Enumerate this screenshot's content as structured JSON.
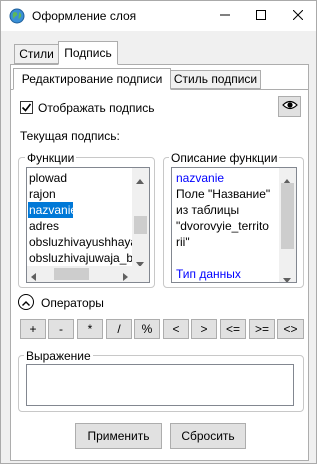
{
  "window": {
    "title": "Оформление слоя",
    "icon": "globe-icon",
    "controls": [
      "minimize-icon",
      "maximize-icon",
      "close-icon"
    ]
  },
  "tabs": {
    "top": [
      {
        "label": "Стили",
        "active": false
      },
      {
        "label": "Подпись",
        "active": true
      }
    ],
    "inner": [
      {
        "label": "Редактирование подписи",
        "active": true
      },
      {
        "label": "Стиль подписи",
        "active": false
      }
    ]
  },
  "label_options": {
    "show_label_text": "Отображать подпись",
    "show_label_checked": true,
    "preview_icon": "eye-icon",
    "current_label_heading": "Текущая подпись:"
  },
  "functions": {
    "legend": "Функции",
    "items": [
      "plowad",
      "rajon",
      "nazvanie",
      "adres",
      "obsluzhivayushhaya",
      "obsluzhivajuwaja_bi"
    ],
    "selected": "nazvanie"
  },
  "description": {
    "legend": "Описание функции",
    "name": "nazvanie",
    "lines": [
      "Поле \"Название\"",
      "из таблицы",
      "\"dvorovyie_territo",
      "rii\""
    ],
    "data_type_label": "Тип данных",
    "link_color": "#0000ff"
  },
  "operators": {
    "toggle_icon": "chevron-up-icon",
    "label": "Операторы",
    "buttons": [
      "+",
      "-",
      "*",
      "/",
      "%",
      "<",
      ">",
      "<=",
      ">=",
      "<>"
    ]
  },
  "expression": {
    "legend": "Выражение",
    "value": ""
  },
  "footer": {
    "apply_label": "Применить",
    "reset_label": "Сбросить"
  },
  "colors": {
    "selection": "#0078d7",
    "link": "#0000ff",
    "window_bg": "#f0f0f0"
  }
}
